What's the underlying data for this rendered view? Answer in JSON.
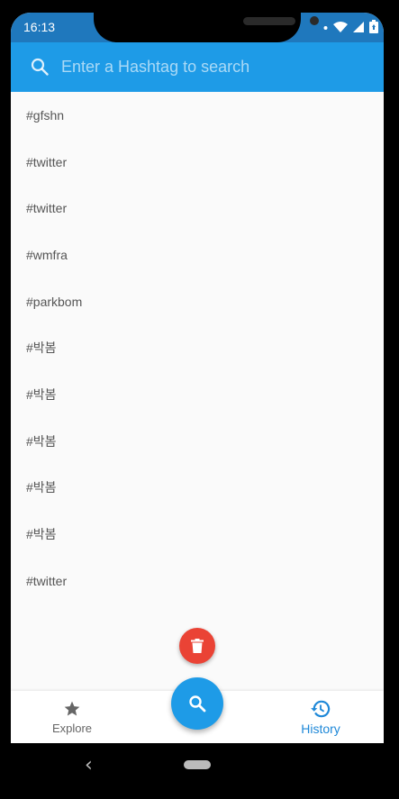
{
  "status_bar": {
    "time": "16:13",
    "icons": [
      "dot-icon",
      "wifi-icon",
      "signal-icon",
      "battery-icon"
    ]
  },
  "search": {
    "placeholder": "Enter a Hashtag to search",
    "value": ""
  },
  "history": {
    "items": [
      "#gfshn",
      "#twitter",
      "#twitter",
      "#wmfra",
      "#parkbom",
      "#박봄",
      "#박봄",
      "#박봄",
      "#박봄",
      "#박봄",
      "#twitter"
    ]
  },
  "fabs": {
    "delete_icon": "trash-icon",
    "search_icon": "search-icon"
  },
  "bottom_nav": {
    "explore_label": "Explore",
    "history_label": "History",
    "active": "History"
  },
  "colors": {
    "header": "#1e9be7",
    "status_bar": "#1f78bd",
    "delete_fab": "#ea4335",
    "active_tab": "#1e88d8"
  }
}
